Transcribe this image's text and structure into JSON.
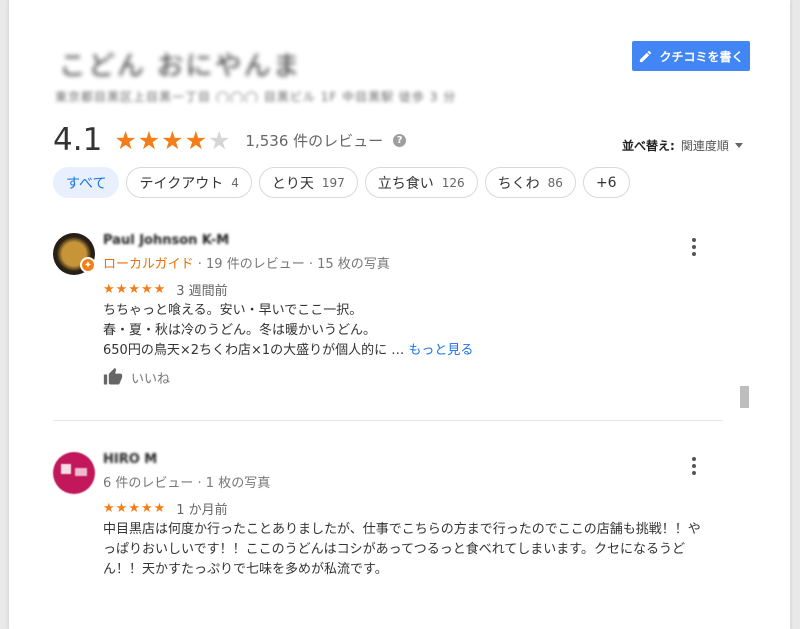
{
  "header": {
    "place_name": "こどん おにやんま",
    "address": "東京都目黒区上目黒一丁目 ◯◯◯ 目黒ビル 1F 中目黒駅 徒歩 3 分",
    "write_review_label": "クチコミを書く"
  },
  "summary": {
    "rating": "4.1",
    "stars_filled": 4,
    "stars_total": 5,
    "review_count": "1,536 件のレビュー",
    "sort_label": "並べ替え:",
    "sort_value": "関連度順"
  },
  "chips": [
    {
      "label": "すべて",
      "count": ""
    },
    {
      "label": "テイクアウト",
      "count": "4"
    },
    {
      "label": "とり天",
      "count": "197"
    },
    {
      "label": "立ち食い",
      "count": "126"
    },
    {
      "label": "ちくわ",
      "count": "86"
    },
    {
      "label": "+6",
      "count": ""
    }
  ],
  "reviews": [
    {
      "name": "Paul Johnson K-M",
      "local_guide": "ローカルガイド",
      "meta": " · 19 件のレビュー · 15 枚の写真",
      "stars": "★★★★★",
      "time": "3 週間前",
      "lines": [
        "ちちゃっと喰える。安い・早いでここ一択。",
        "春・夏・秋は冷のうどん。冬は暖かいうどん。",
        "650円の鳥天×2ちくわ店×1の大盛りが個人的に …"
      ],
      "more_label": "もっと見る",
      "like_label": "いいね"
    },
    {
      "name": "HIRO M",
      "meta": "6 件のレビュー · 1 枚の写真",
      "stars": "★★★★★",
      "time": "1 か月前",
      "lines": [
        "中目黒店は何度か行ったことありましたが、仕事でこちらの方まで行ったのでここの店舗も挑戦！！や",
        "っぱりおいしいです！！ここのうどんはコシがあってつるっと食べれてしまいます。クセになるうど",
        "ん！！天かすたっぷりで七味を多めが私流です。"
      ]
    }
  ],
  "colors": {
    "accent": "#4285f4",
    "star": "#f57d17",
    "local_guide": "#e8710a",
    "link": "#1a73e8"
  }
}
